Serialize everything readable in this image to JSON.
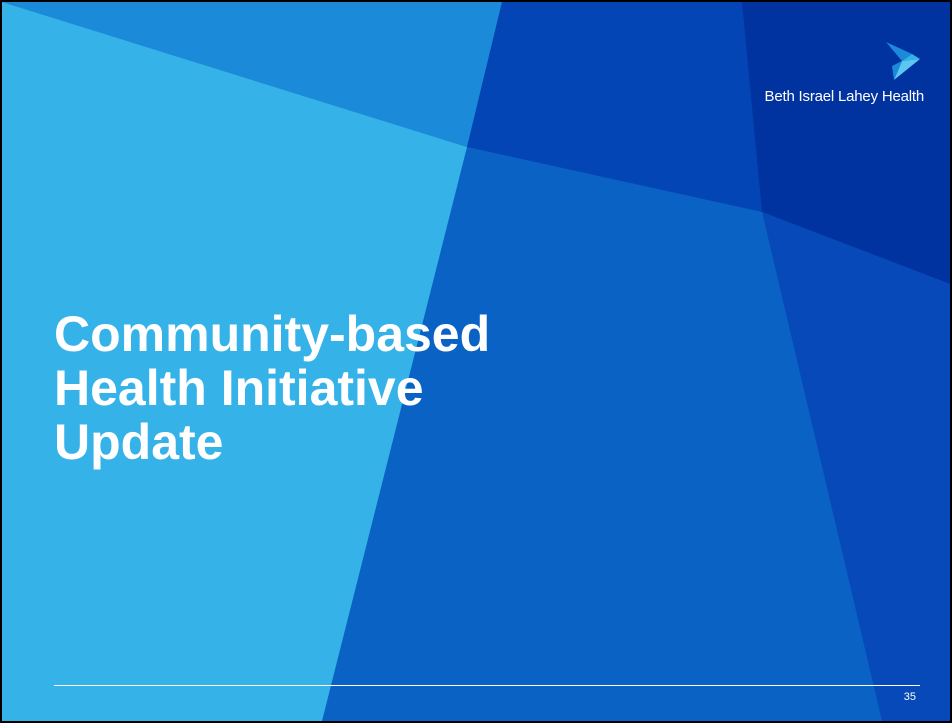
{
  "slide": {
    "title_lines": [
      "Community-based",
      "Health Initiative",
      "Update"
    ],
    "page_number": "35"
  },
  "logo": {
    "text": "Beth Israel Lahey Health",
    "icon": "bird-arrow-logo-mark"
  },
  "colors": {
    "light_blue": "#35b2e8",
    "medium_blue": "#1a8ad9",
    "blue": "#0a63c4",
    "dark_blue": "#0445b5",
    "navy": "#0033a0",
    "text": "#ffffff"
  }
}
